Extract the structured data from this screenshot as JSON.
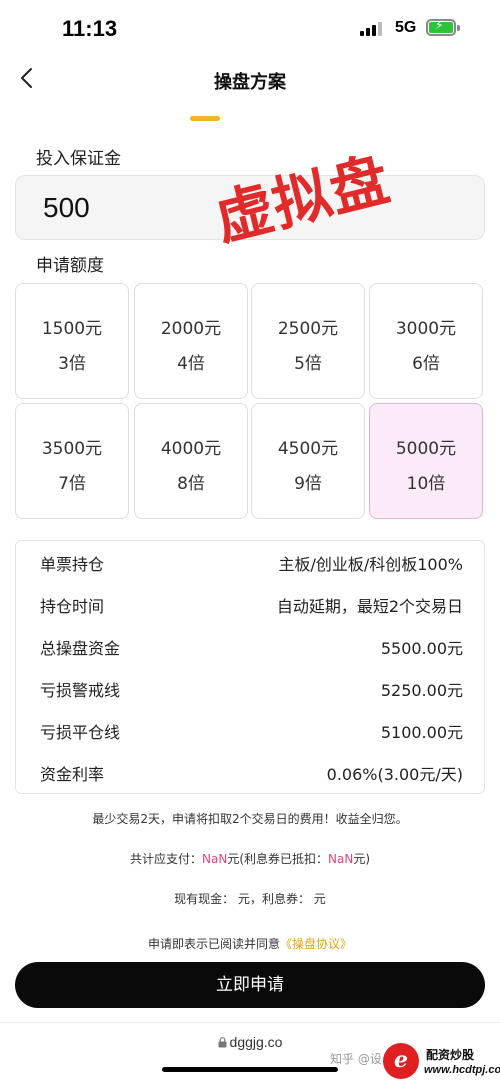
{
  "status_bar": {
    "time": "11:13",
    "network": "5G"
  },
  "nav": {
    "title": "操盘方案"
  },
  "deposit": {
    "label": "投入保证金",
    "value": "500"
  },
  "watermark": "虚拟盘",
  "quota": {
    "label": "申请额度",
    "options": [
      {
        "amount": "1500元",
        "multiplier": "3倍"
      },
      {
        "amount": "2000元",
        "multiplier": "4倍"
      },
      {
        "amount": "2500元",
        "multiplier": "5倍"
      },
      {
        "amount": "3000元",
        "multiplier": "6倍"
      },
      {
        "amount": "3500元",
        "multiplier": "7倍"
      },
      {
        "amount": "4000元",
        "multiplier": "8倍"
      },
      {
        "amount": "4500元",
        "multiplier": "9倍"
      },
      {
        "amount": "5000元",
        "multiplier": "10倍"
      }
    ],
    "selected": "5000元"
  },
  "info": [
    {
      "label": "单票持仓",
      "value": "主板/创业板/科创板100%"
    },
    {
      "label": "持仓时间",
      "value": "自动延期，最短2个交易日"
    },
    {
      "label": "总操盘资金",
      "value": "5500.00元"
    },
    {
      "label": "亏损警戒线",
      "value": "5250.00元"
    },
    {
      "label": "亏损平仓线",
      "value": "5100.00元"
    },
    {
      "label": "资金利率",
      "value": "0.06%(3.00元/天)"
    }
  ],
  "notes": {
    "min_trade": "最少交易2天，申请将扣取2个交易日的费用！收益全归您。",
    "payable_prefix": "共计应支付：",
    "payable_value": "NaN",
    "payable_mid": "元(利息券已抵扣：",
    "payable_coupon": "NaN",
    "payable_suffix": "元)",
    "balance": "现有现金：  元，利息券：  元",
    "agree_prefix": "申请即表示已阅读并同意",
    "agree_link": "《操盘协议》"
  },
  "submit_label": "立即申请",
  "browser_url": "dggjg.co",
  "overlay": {
    "corner_text": "知乎 @设...",
    "logo_letter": "e",
    "logo_name": "配资炒股",
    "logo_url": "www.hcdtpj.com"
  },
  "colors": {
    "accent": "#f0b429",
    "watermark": "#e12a2a",
    "selected_bg": "#fbeaf7",
    "nan": "#e0457a",
    "button": "#0a0a0a"
  }
}
